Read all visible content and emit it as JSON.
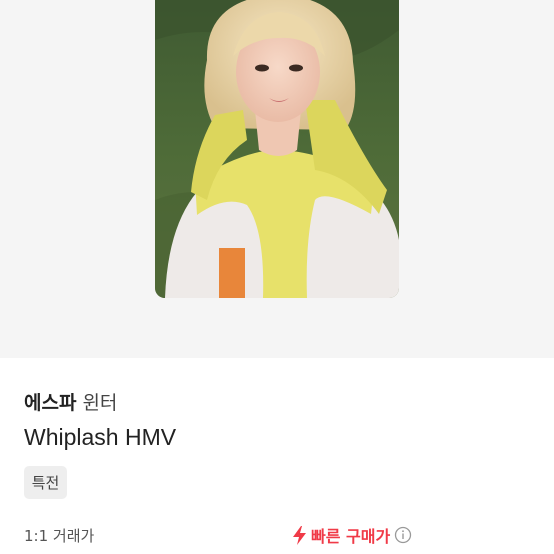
{
  "product": {
    "group": "에스파",
    "member": "윈터",
    "title": "Whiplash HMV",
    "tag": "특전"
  },
  "trade": {
    "label": "1:1 거래가"
  },
  "quick_buy": {
    "label": "빠른 구매가",
    "icon": "lightning-bolt-icon",
    "info_icon": "info-circle-icon",
    "color": "#f03a47"
  },
  "photo": {
    "alt": "Photocard image",
    "background": "#f5f5f5"
  }
}
